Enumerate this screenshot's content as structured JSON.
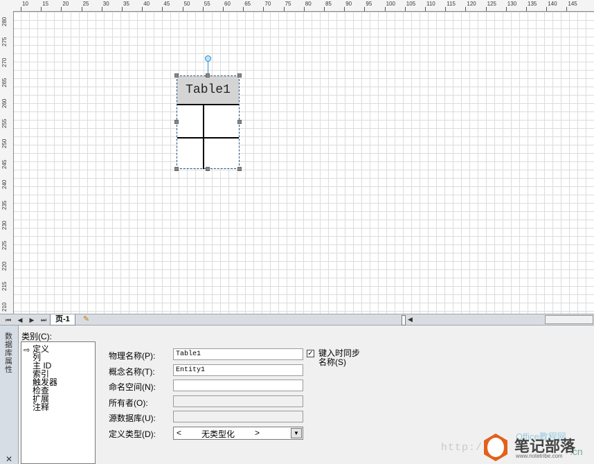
{
  "ruler": {
    "top_labels": [
      "10",
      "15",
      "20",
      "25",
      "30",
      "35",
      "40",
      "45",
      "50",
      "55",
      "60",
      "65",
      "70",
      "75",
      "80",
      "85",
      "90",
      "95",
      "100",
      "105",
      "110",
      "115",
      "120",
      "125",
      "130",
      "135",
      "140",
      "145"
    ],
    "left_labels": [
      "280",
      "275",
      "270",
      "265",
      "260",
      "255",
      "250",
      "245",
      "240",
      "235",
      "230",
      "225",
      "220",
      "215",
      "210"
    ]
  },
  "canvas": {
    "table_shape": {
      "name": "Table1"
    }
  },
  "tabs": {
    "nav_first": "⏮",
    "nav_prev": "◀",
    "nav_next": "▶",
    "nav_last": "⏭",
    "page_tab": "页-1"
  },
  "side_panel": {
    "title": "数据库属性",
    "close": "✕"
  },
  "category": {
    "label": "类别(C):",
    "items": [
      "定义",
      "列",
      "主 ID",
      "索引",
      "触发器",
      "检查",
      "扩展",
      "注释"
    ]
  },
  "form": {
    "physical_name_label": "物理名称(P):",
    "physical_name_value": "Table1",
    "conceptual_name_label": "概念名称(T):",
    "conceptual_name_value": "Entity1",
    "namespace_label": "命名空间(N):",
    "namespace_value": "",
    "owner_label": "所有者(O):",
    "owner_value": "",
    "source_db_label": "源数据库(U):",
    "source_db_value": "",
    "def_type_label": "定义类型(D):",
    "def_type_left": "<",
    "def_type_value": "无类型化",
    "def_type_right": ">",
    "sync_checked": true,
    "sync_label": "键入时同步名称(S)"
  },
  "watermark": {
    "url": "http://",
    "office": "Office教程网",
    "name": "笔记部落",
    "sub": "www.notetribe.com",
    "cn": ".cn"
  },
  "colors": {
    "grid": "#dcdcdc",
    "selection": "#1d4f7a",
    "header_fill": "#d4d4d4",
    "panel_bg": "#f0f0f0",
    "accent_orange": "#e2601a"
  }
}
